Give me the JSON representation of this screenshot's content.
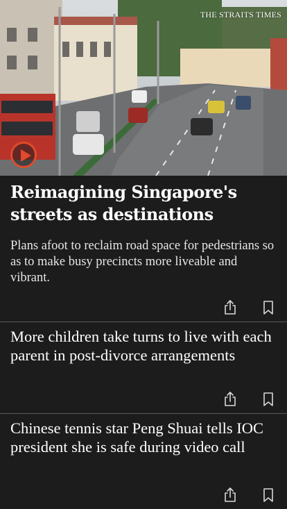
{
  "hero": {
    "logo_text": "THE STRAITS TIMES",
    "play_icon": "play-icon"
  },
  "articles": [
    {
      "headline": "Reimagining Singapore's streets as destinations",
      "standfirst": "Plans afoot to reclaim road space for pedestrians so as to make busy precincts more liveable and vibrant."
    },
    {
      "headline": "More children take turns to live with each parent in post-divorce arrangements"
    },
    {
      "headline": "Chinese tennis star Peng Shuai tells IOC president she is safe during video call"
    }
  ],
  "icons": {
    "share": "share-icon",
    "bookmark": "bookmark-icon"
  },
  "colors": {
    "background": "#1c1c1c",
    "accent": "#e24a2b",
    "divider": "#5a5a5a"
  }
}
